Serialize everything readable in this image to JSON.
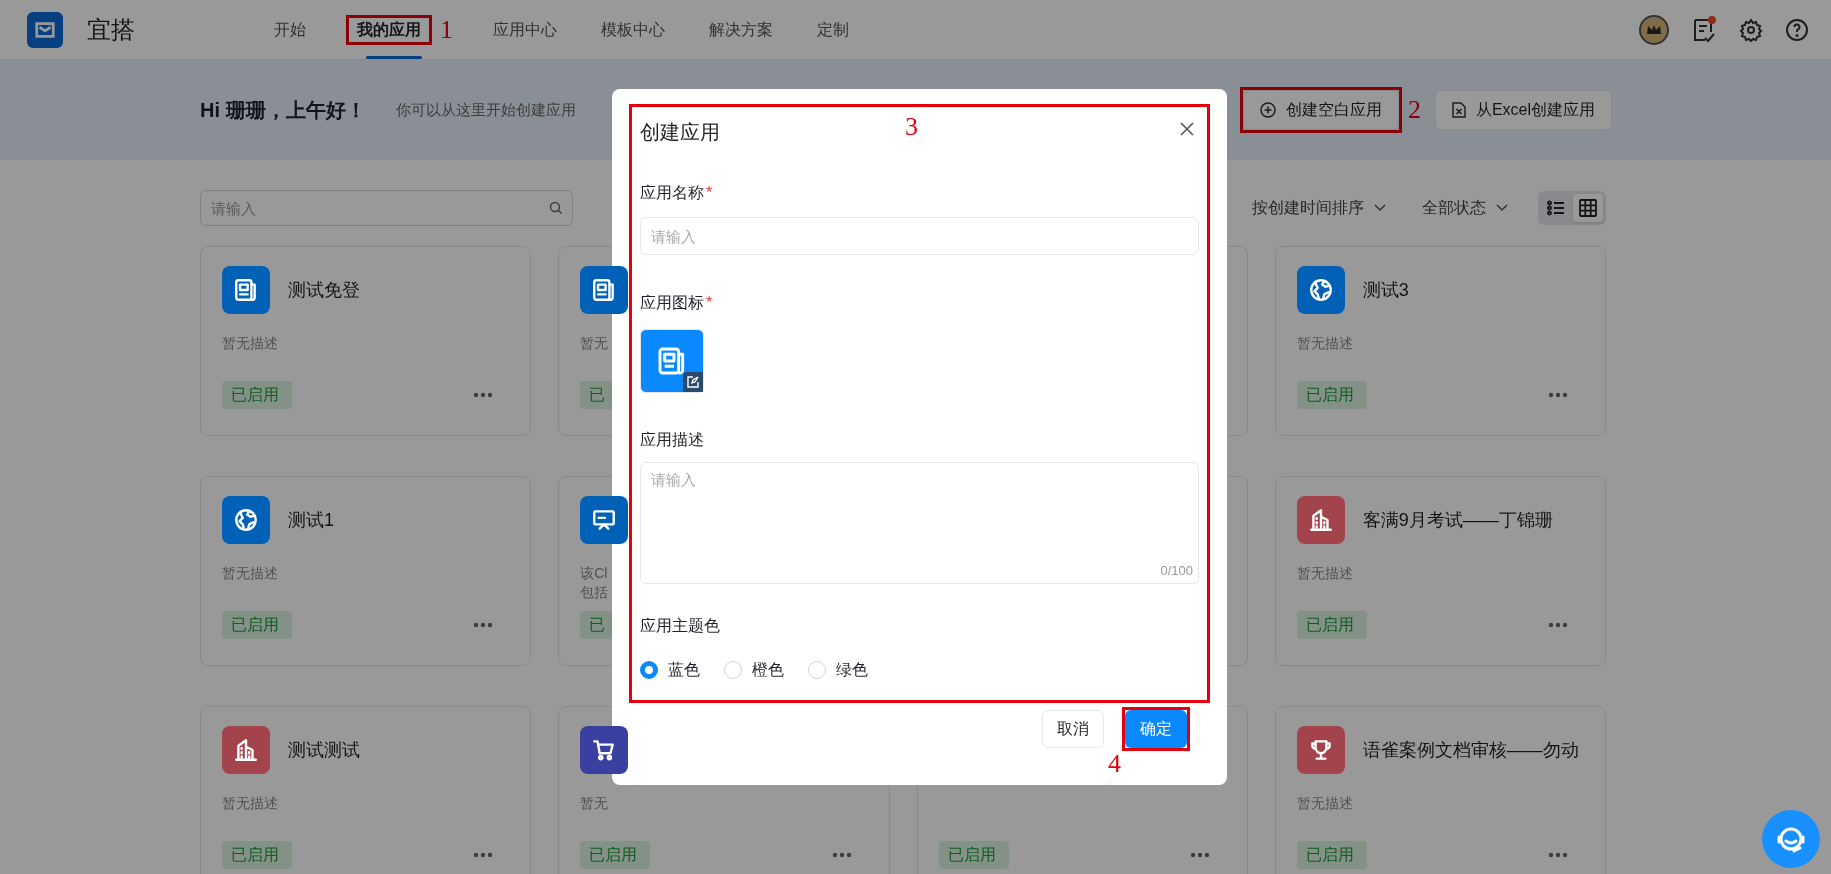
{
  "app": {
    "title": "宜搭"
  },
  "nav": [
    {
      "label": "开始",
      "selected": false
    },
    {
      "label": "我的应用",
      "selected": true,
      "annotation": "1"
    },
    {
      "label": "应用中心",
      "selected": false
    },
    {
      "label": "模板中心",
      "selected": false
    },
    {
      "label": "解决方案",
      "selected": false
    },
    {
      "label": "定制",
      "selected": false
    }
  ],
  "banner": {
    "greeting": "Hi 珊珊，上午好！",
    "subtitle": "你可以从这里开始创建应用",
    "buttons": [
      {
        "label": "创建空白应用",
        "kind": "plus",
        "annotation": "2"
      },
      {
        "label": "从Excel创建应用",
        "kind": "excel"
      }
    ]
  },
  "toolbar": {
    "search_placeholder": "请输入",
    "sort": "按创建时间排序",
    "filter": "全部状态",
    "views": [
      {
        "kind": "list",
        "selected": false
      },
      {
        "kind": "grid",
        "selected": true
      }
    ]
  },
  "cards": [
    {
      "kind": "newspaper",
      "name": "测试免登",
      "description": [
        "暂无描述"
      ],
      "status": "已启用",
      "color": "#0061b6",
      "more_menu": true
    },
    {
      "kind": "newspaper",
      "description": [
        "暂无"
      ],
      "status": "已",
      "color": "#0061b6",
      "more_menu": false
    },
    {
      "kind": "covered"
    },
    {
      "kind": "globe",
      "name": "测试3",
      "description": [
        "暂无描述"
      ],
      "status": "已启用",
      "color": "#0061b6",
      "more_menu": true
    },
    {
      "kind": "globe",
      "name": "测试1",
      "description": [
        "暂无描述"
      ],
      "status": "已启用",
      "color": "#0061b6",
      "more_menu": true
    },
    {
      "kind": "board",
      "description": [
        "该Cl",
        "包括"
      ],
      "status": "已",
      "color": "#0061b6",
      "more_menu": false
    },
    {
      "kind": "covered"
    },
    {
      "kind": "building",
      "name": "客满9月考试——丁锦珊",
      "description": [
        "暂无描述"
      ],
      "status": "已启用",
      "color": "#a3434c",
      "more_menu": true
    },
    {
      "kind": "building",
      "name": "测试测试",
      "description": [
        "暂无描述"
      ],
      "status": "已启用",
      "color": "#a3434c",
      "more_menu": true
    },
    {
      "kind": "cart",
      "description": [
        "暂无"
      ],
      "status": "已启用",
      "color": "#3a40a0",
      "more_menu": true
    },
    {
      "kind": "plain",
      "status": "已启用",
      "more_menu": true
    },
    {
      "kind": "trophy",
      "name": "语雀案例文档审核——勿动",
      "description": [
        "暂无描述"
      ],
      "status": "已启用",
      "color": "#a3434c",
      "more_menu": true
    }
  ],
  "modal": {
    "title": "创建应用",
    "annotation": "3",
    "name_label": "应用名称",
    "name_required": "*",
    "name_placeholder": "请输入",
    "icon_label": "应用图标",
    "icon_required": "*",
    "description_label": "应用描述",
    "description_placeholder": "请输入",
    "counter": "0/100",
    "theme_label": "应用主题色",
    "theme_options": [
      {
        "label": "蓝色",
        "selected": true
      },
      {
        "label": "橙色",
        "selected": false
      },
      {
        "label": "绿色",
        "selected": false
      }
    ],
    "buttons": [
      {
        "label": "取消",
        "kind": "secondary"
      },
      {
        "label": "确定",
        "kind": "primary",
        "annotation": "4"
      }
    ]
  }
}
